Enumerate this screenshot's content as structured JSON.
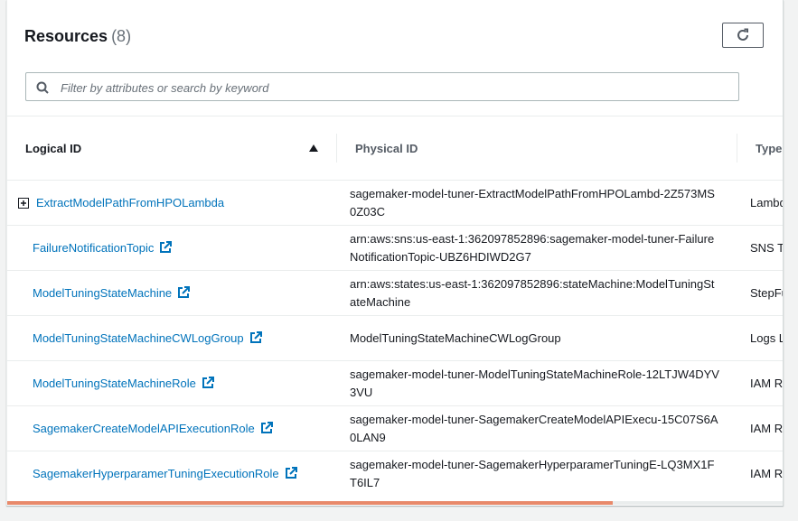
{
  "header": {
    "title": "Resources",
    "count": "(8)"
  },
  "search": {
    "placeholder": "Filter by attributes or search by keyword"
  },
  "columns": {
    "logical": "Logical ID",
    "physical": "Physical ID",
    "type": "Type"
  },
  "rows": [
    {
      "logical": "ExtractModelPathFromHPOLambda",
      "physical": "sagemaker-model-tuner-ExtractModelPathFromHPOLambd-2Z573MS0Z03C",
      "type": "Lambda Function"
    },
    {
      "logical": "FailureNotificationTopic",
      "physical": "arn:aws:sns:us-east-1:362097852896:sagemaker-model-tuner-FailureNotificationTopic-UBZ6HDIWD2G7",
      "type": "SNS Topic"
    },
    {
      "logical": "ModelTuningStateMachine",
      "physical": "arn:aws:states:us-east-1:362097852896:stateMachine:ModelTuningStateMachine",
      "type": "StepFunctions StateMachine"
    },
    {
      "logical": "ModelTuningStateMachineCWLogGroup",
      "physical": "ModelTuningStateMachineCWLogGroup",
      "type": "Logs LogGroup"
    },
    {
      "logical": "ModelTuningStateMachineRole",
      "physical": "sagemaker-model-tuner-ModelTuningStateMachineRole-12LTJW4DYV3VU",
      "type": "IAM Role"
    },
    {
      "logical": "SagemakerCreateModelAPIExecutionRole",
      "physical": "sagemaker-model-tuner-SagemakerCreateModelAPIExecu-15C07S6A0LAN9",
      "type": "IAM Role"
    },
    {
      "logical": "SagemakerHyperparamerTuningExecutionRole",
      "physical": "sagemaker-model-tuner-SagemakerHyperparamerTuningE-LQ3MX1FT6IL7",
      "type": "IAM Role"
    }
  ],
  "colors": {
    "link": "#0073bb",
    "scroll_thumb": "#e8896a"
  }
}
